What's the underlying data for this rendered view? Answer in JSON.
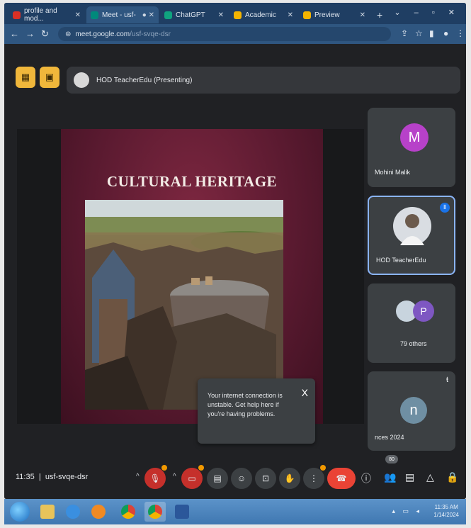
{
  "browser": {
    "tabs": [
      {
        "label": "profile and mod...",
        "icon": "gmail-icon",
        "color": "#d93025"
      },
      {
        "label": "Meet - usf-",
        "icon": "meet-icon",
        "color": "#00897b",
        "active": true
      },
      {
        "label": "ChatGPT",
        "icon": "chatgpt-icon",
        "color": "#10a37f"
      },
      {
        "label": "Academic",
        "icon": "doc-icon",
        "color": "#f4b400"
      },
      {
        "label": "Preview",
        "icon": "doc-icon",
        "color": "#f4b400"
      }
    ],
    "url_host": "meet.google.com",
    "url_path": "/usf-svqe-dsr"
  },
  "meet": {
    "presenter_label": "HOD TeacherEdu (Presenting)",
    "slide_title": "CULTURAL HERITAGE",
    "participants": [
      {
        "name": "Mohini Malik",
        "initial": "M",
        "color": "#b741c9"
      },
      {
        "name": "HOD TeacherEdu",
        "initial": "",
        "color": "#d9dde2"
      },
      {
        "name": "79 others",
        "initial": "P",
        "color": "#7e57c2"
      },
      {
        "name": "nces 2024",
        "initial": "n",
        "color": "#6f8fa3"
      }
    ],
    "toast_text": "Your internet connection is unstable. Get help here if you're having problems.",
    "toast_close": "X",
    "time": "11:35",
    "meeting_code": "usf-svqe-dsr",
    "people_count": "80"
  },
  "taskbar": {
    "clock_time": "11:35 AM",
    "clock_date": "1/14/2024"
  }
}
